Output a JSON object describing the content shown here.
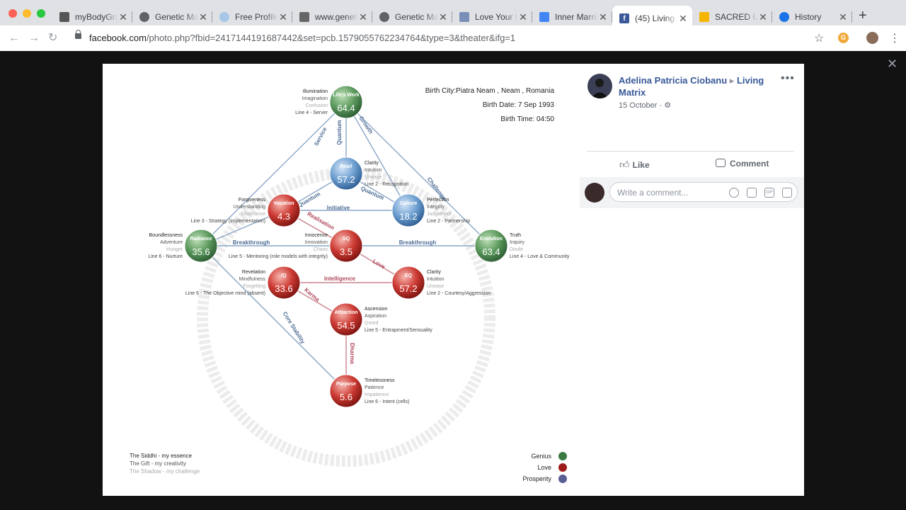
{
  "browser": {
    "tabs": [
      {
        "title": "myBodyGraph",
        "icon": "person-icon",
        "color": "#555555"
      },
      {
        "title": "Genetic Matrix",
        "icon": "globe-icon",
        "color": "#5f6368"
      },
      {
        "title": "Free Profile",
        "icon": "cloud-icon",
        "color": "#a8c7e8"
      },
      {
        "title": "www.genetic",
        "icon": "page-icon",
        "color": "#666666"
      },
      {
        "title": "Genetic Matrix",
        "icon": "globe-icon",
        "color": "#5f6368"
      },
      {
        "title": "Love Your Life",
        "icon": "plane-icon",
        "color": "#7a8fb8"
      },
      {
        "title": "Inner Marriage",
        "icon": "docs-icon",
        "color": "#4285f4"
      },
      {
        "title": "(45) Living",
        "icon": "facebook-icon",
        "color": "#3b5998",
        "active": true
      },
      {
        "title": "SACRED UNION",
        "icon": "slides-icon",
        "color": "#f4b400"
      },
      {
        "title": "History",
        "icon": "history-icon",
        "color": "#1a73e8"
      }
    ],
    "url_host": "facebook.com",
    "url_path": "/photo.php?fbid=2417144191687442&set=pcb.1579055762234764&type=3&theater&ifg=1",
    "new_tab": "+"
  },
  "post": {
    "author": "Adelina Patricia Ciobanu",
    "group_arrow": "▸",
    "group": "Living Matrix",
    "date": "15 October",
    "privacy_glyph": "⚙",
    "more": "•••",
    "like_label": "Like",
    "comment_label": "Comment",
    "comment_placeholder": "Write a comment..."
  },
  "matrix": {
    "birth_city": "Birth City:Piatra Neam , Neam , Romania",
    "birth_date": "Birth Date: 7 Sep 1993",
    "birth_time": "Birth Time: 04:50",
    "legend_left": [
      "The Siddhi - my essence",
      "The Gift - my creativity",
      "The Shadow - my challenge"
    ],
    "legend_right": [
      {
        "label": "Genius",
        "color": "#3b7a45"
      },
      {
        "label": "Love",
        "color": "#9e1b1b"
      },
      {
        "label": "Prosperity",
        "color": "#5a5f94"
      }
    ],
    "nodes": [
      {
        "id": "lifes-work",
        "name": "Life's Work",
        "value": "64.4",
        "color": "green",
        "texts": [
          "Illumination",
          "Imagination",
          "Confusion",
          "Line 4 - Server"
        ],
        "side": "left"
      },
      {
        "id": "pearl",
        "name": "Pearl",
        "value": "57.2",
        "color": "blue",
        "texts": [
          "Clarity",
          "Intuition",
          "Unease",
          "Line 2 - Recognition"
        ],
        "side": "right"
      },
      {
        "id": "vocation",
        "name": "Vocation",
        "value": "4.3",
        "color": "red",
        "texts": [
          "Forgiveness",
          "Understanding",
          "Intolerance",
          "Line 3 - Strategy (implementation)"
        ],
        "side": "left"
      },
      {
        "id": "culture",
        "name": "Culture",
        "value": "18.2",
        "color": "blue",
        "texts": [
          "Perfection",
          "Integrity",
          "Judgement",
          "Line 2 - Partnership"
        ],
        "side": "right"
      },
      {
        "id": "radiance",
        "name": "Radiance",
        "value": "35.6",
        "color": "green",
        "texts": [
          "Boundlessness",
          "Adventure",
          "Hunger",
          "Line 6 - Nurture"
        ],
        "side": "left"
      },
      {
        "id": "sq",
        "name": "SQ",
        "value": "3.5",
        "color": "red",
        "texts": [
          "Innocence",
          "Innovation",
          "Chaos",
          "Line 5 - Mentoring (role models with integrity)"
        ],
        "side": "left"
      },
      {
        "id": "evolution",
        "name": "Evolution",
        "value": "63.4",
        "color": "green",
        "texts": [
          "Truth",
          "Inquiry",
          "Doubt",
          "Line 4 - Love & Community"
        ],
        "side": "right"
      },
      {
        "id": "iq",
        "name": "IQ",
        "value": "33.6",
        "color": "red",
        "texts": [
          "Revelation",
          "Mindfulness",
          "Forgetting",
          "Line 6 - The Objective mind (absent)"
        ],
        "side": "left"
      },
      {
        "id": "eq",
        "name": "EQ",
        "value": "57.2",
        "color": "red",
        "texts": [
          "Clarity",
          "Intuition",
          "Unease",
          "Line 2 - Courtesy/Aggression"
        ],
        "side": "right"
      },
      {
        "id": "attraction",
        "name": "Attraction",
        "value": "54.5",
        "color": "red",
        "texts": [
          "Ascension",
          "Aspiration",
          "Greed",
          "Line 5 - Entrapment/Sensuality"
        ],
        "side": "right"
      },
      {
        "id": "purpose",
        "name": "Purpose",
        "value": "5.6",
        "color": "red",
        "texts": [
          "Timelessness",
          "Patience",
          "Impatience",
          "Line 6 - Intent (cells)"
        ],
        "side": "right"
      }
    ],
    "edge_labels": [
      "Quantum",
      "Service",
      "Growth",
      "Challenge",
      "Quantum",
      "Quantum",
      "Initiative",
      "Realisation",
      "Breakthrough",
      "Breakthrough",
      "Love",
      "Intelligence",
      "Karma",
      "Core Stability",
      "Dharma"
    ]
  }
}
